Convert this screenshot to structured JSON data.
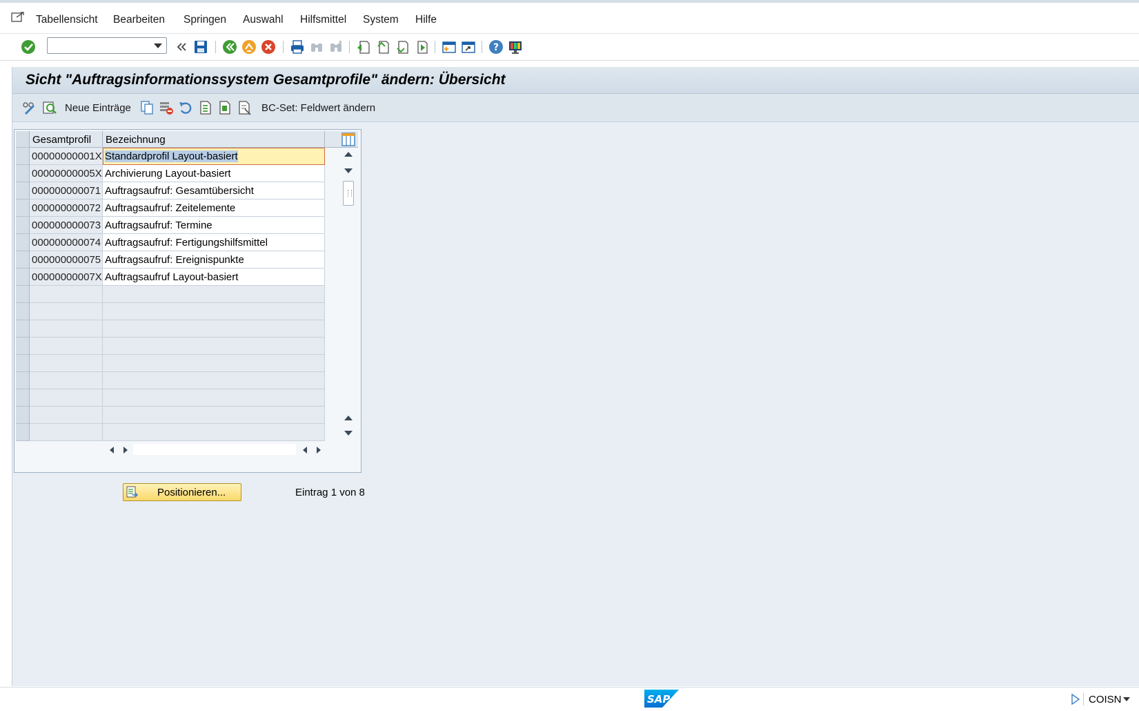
{
  "menu": {
    "items": [
      "Tabellensicht",
      "Bearbeiten",
      "Springen",
      "Auswahl",
      "Hilfsmittel",
      "System",
      "Hilfe"
    ]
  },
  "toolbar": {
    "command_value": "",
    "icons": [
      "enter-icon",
      "command-dropdown",
      "expand-icon",
      "save-icon",
      "back-icon",
      "exit-icon",
      "cancel-icon",
      "print-icon",
      "find-icon",
      "find-next-icon",
      "first-page-icon",
      "previous-page-icon",
      "next-page-icon",
      "last-page-icon",
      "create-session-icon",
      "shortcut-icon",
      "help-icon",
      "customize-layout-icon"
    ]
  },
  "page": {
    "title": "Sicht \"Auftragsinformationssystem Gesamtprofile\" ändern: Übersicht"
  },
  "app_toolbar": {
    "new_entries_label": "Neue Einträge",
    "bcset_label": "BC-Set: Feldwert ändern"
  },
  "table": {
    "columns": [
      "Gesamtprofil",
      "Bezeichnung"
    ],
    "rows": [
      [
        "00000000001X",
        "Standardprofil Layout-basiert"
      ],
      [
        "00000000005X",
        "Archivierung Layout-basiert"
      ],
      [
        "000000000071",
        "Auftragsaufruf: Gesamtübersicht"
      ],
      [
        "000000000072",
        "Auftragsaufruf: Zeitelemente"
      ],
      [
        "000000000073",
        "Auftragsaufruf: Termine"
      ],
      [
        "000000000074",
        "Auftragsaufruf: Fertigungshilfsmittel"
      ],
      [
        "000000000075",
        "Auftragsaufruf: Ereignispunkte"
      ],
      [
        "00000000007X",
        "Auftragsaufruf Layout-basiert"
      ]
    ],
    "empty_rows": 9,
    "selected_row": 0
  },
  "footer": {
    "position_button_label": "Positionieren...",
    "entry_info": "Eintrag 1 von 8"
  },
  "status": {
    "system": "COISN"
  },
  "colors": {
    "content_bg": "#e8eef4",
    "active_cell": "#fff2b3",
    "button_yellow": "#fbd96a",
    "accent_blue": "#0a6ed1"
  }
}
